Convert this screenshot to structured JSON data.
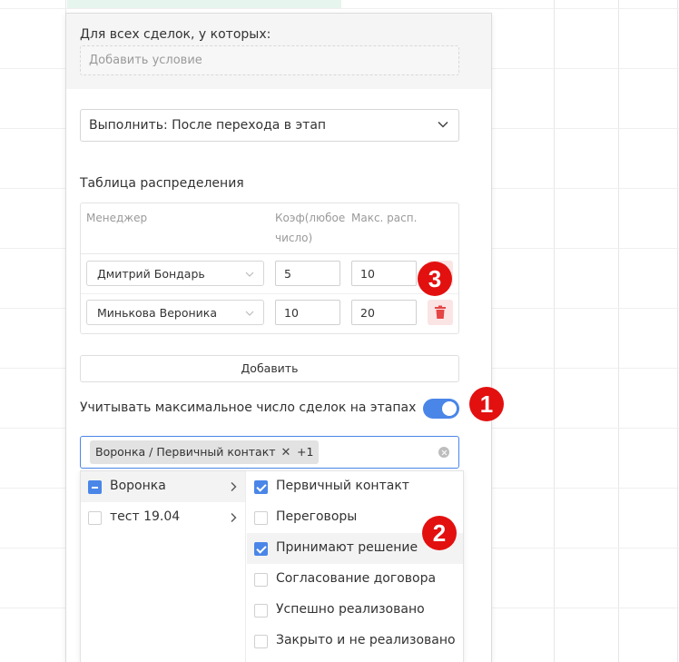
{
  "conditions": {
    "title": "Для всех сделок, у которых:",
    "placeholder": "Добавить условие"
  },
  "execute": {
    "value": "Выполнить: После перехода в этап"
  },
  "distribution": {
    "title": "Таблица распределения",
    "columns": {
      "manager": "Менеджер",
      "coef_line1": "Коэф(любое",
      "coef_line2": "число)",
      "max": "Макс. расп."
    },
    "rows": [
      {
        "manager": "Дмитрий Бондарь",
        "coef": "5",
        "max": "10"
      },
      {
        "manager": "Минькова Вероника",
        "coef": "10",
        "max": "20"
      }
    ],
    "add_label": "Добавить"
  },
  "stage_limit": {
    "label": "Учитывать максимальное число сделок на этапах",
    "enabled": true
  },
  "stage_select": {
    "tags": [
      "Воронка / Первичный контакт",
      "+1"
    ]
  },
  "pipelines": [
    {
      "label": "Воронка",
      "state": "partial"
    },
    {
      "label": "тест 19.04",
      "state": "unchecked"
    }
  ],
  "stages": [
    {
      "label": "Первичный контакт",
      "checked": true
    },
    {
      "label": "Переговоры",
      "checked": false
    },
    {
      "label": "Принимают решение",
      "checked": true
    },
    {
      "label": "Согласование договора",
      "checked": false
    },
    {
      "label": "Успешно реализовано",
      "checked": false
    },
    {
      "label": "Закрыто и не реализовано",
      "checked": false
    }
  ],
  "annotations": [
    "1",
    "2",
    "3"
  ],
  "colors": {
    "accent": "#4a86e8",
    "badge": "#e31010",
    "delete_bg": "#fbe4e4",
    "delete_icon": "#e64545"
  }
}
